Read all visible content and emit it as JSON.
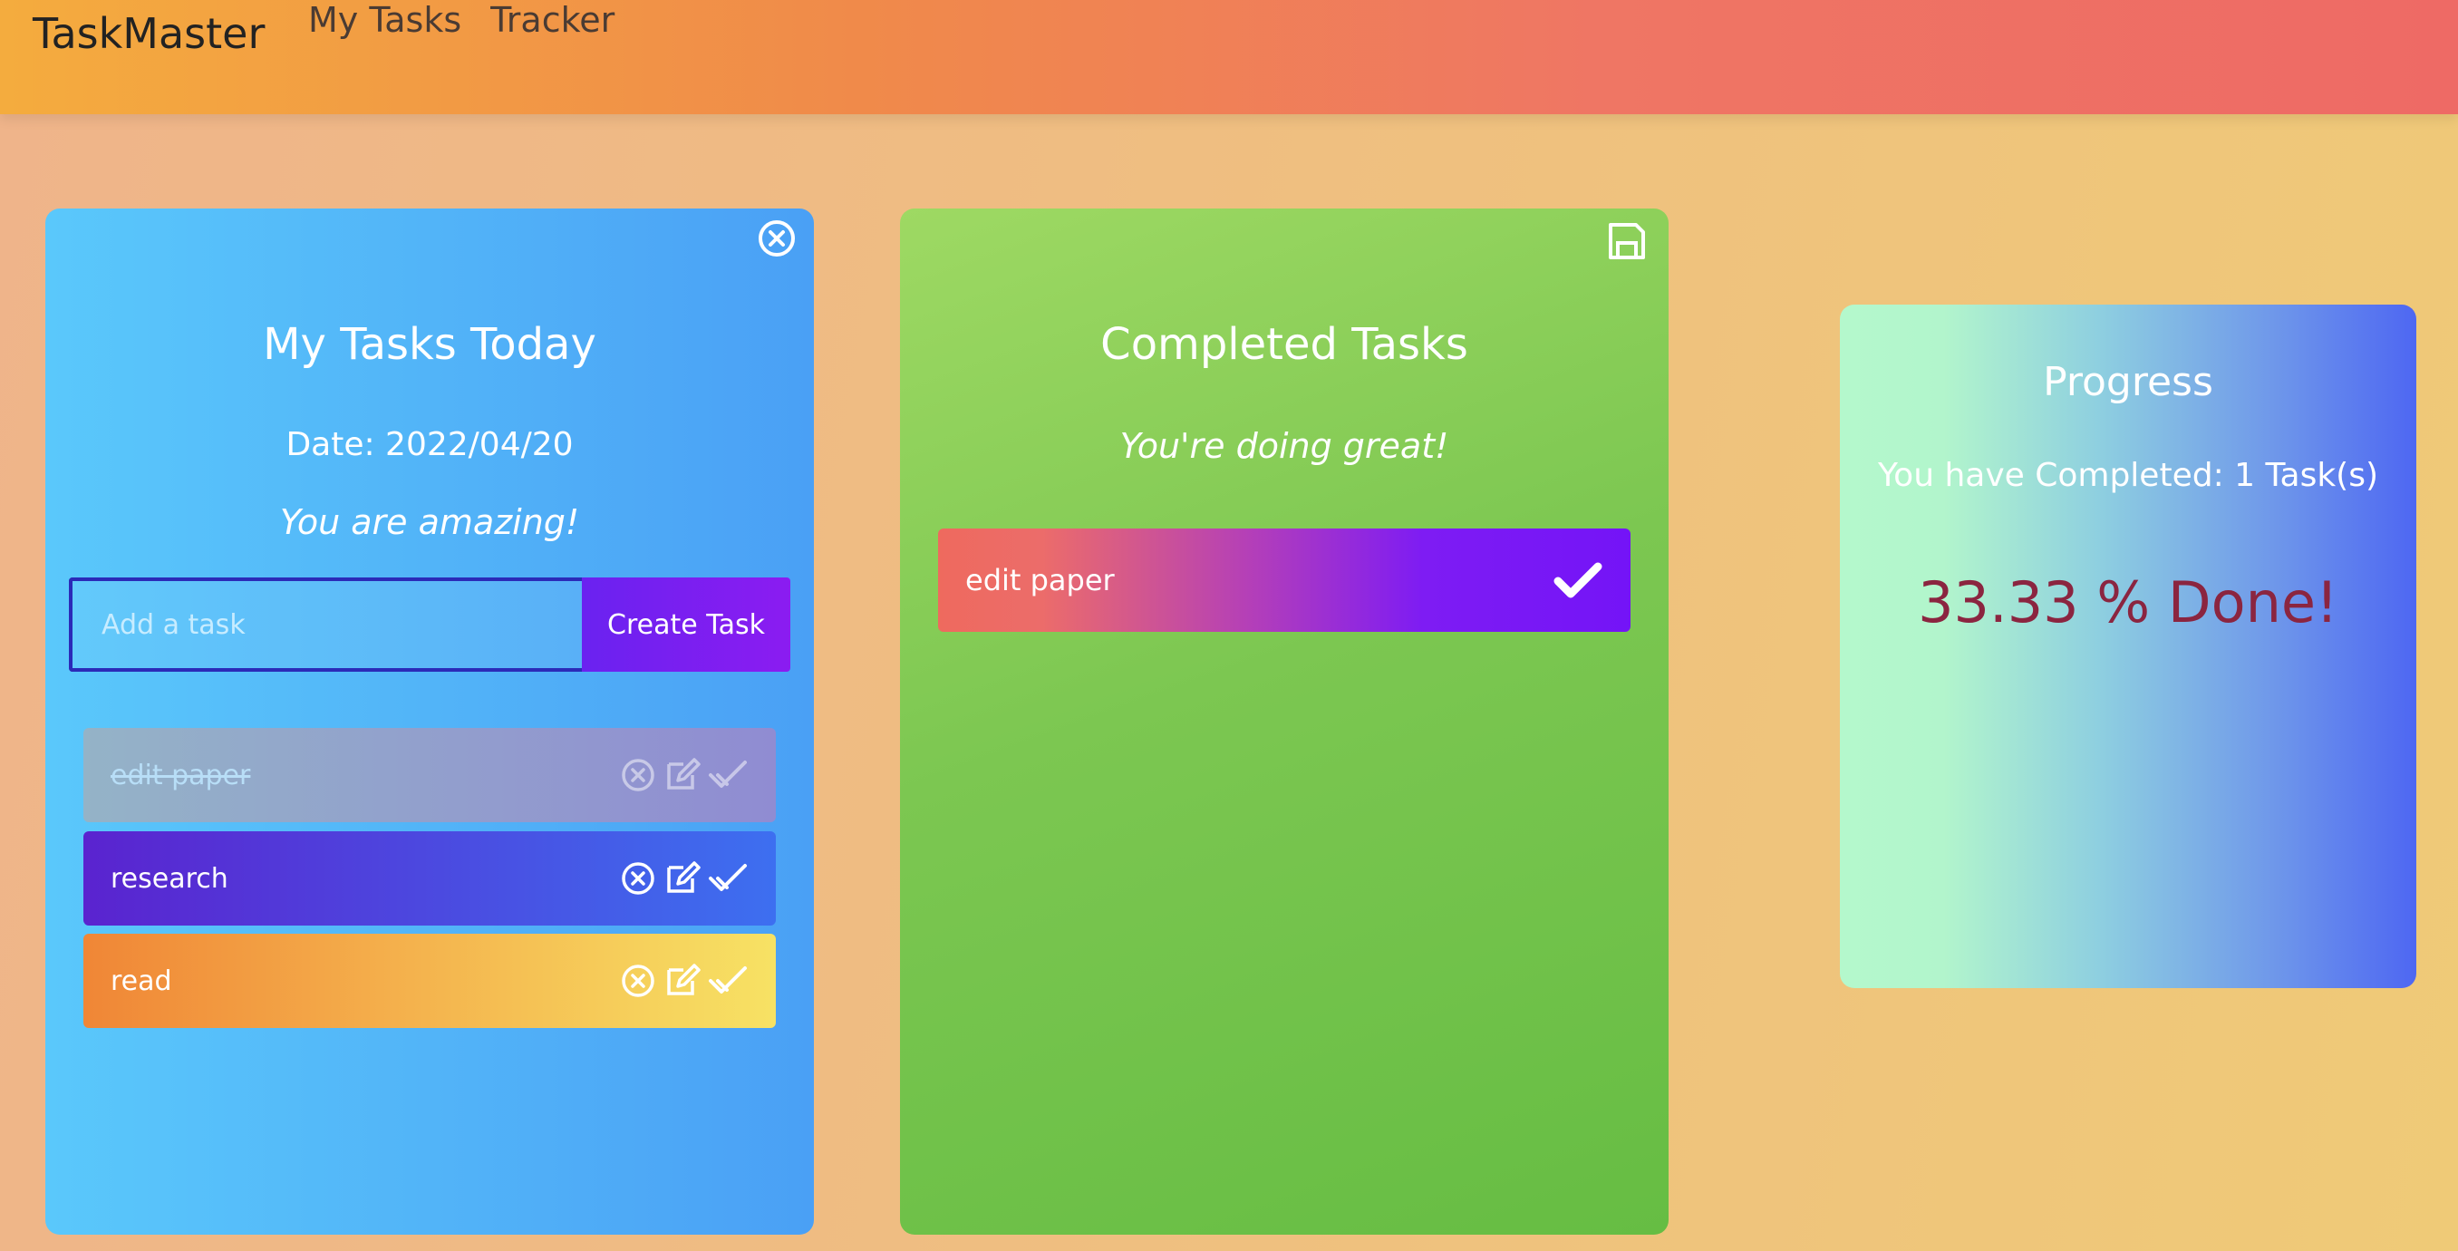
{
  "header": {
    "brand": "TaskMaster",
    "nav": [
      "My Tasks",
      "Tracker"
    ]
  },
  "tasks_card": {
    "title": "My Tasks Today",
    "date": "Date: 2022/04/20",
    "motto": "You are amazing!",
    "input_placeholder": "Add a task",
    "input_value": "",
    "create_label": "Create Task",
    "items": [
      {
        "label": "edit paper",
        "completed": true
      },
      {
        "label": "research",
        "completed": false
      },
      {
        "label": "read",
        "completed": false
      }
    ]
  },
  "completed_card": {
    "title": "Completed Tasks",
    "motto": "You're doing great!",
    "items": [
      {
        "label": "edit paper"
      }
    ]
  },
  "progress_card": {
    "title": "Progress",
    "summary": "You have Completed: 1 Task(s)",
    "percent_text": "33.33 % Done!",
    "percent_value": 33.33
  },
  "colors": {
    "percent_text": "#8b2540",
    "brand_text": "#222222",
    "nav_text": "#4a3b33",
    "input_border": "#2b2ab8",
    "create_button": "#7a1ff2"
  },
  "icons": {
    "close": "close-circle-icon",
    "save": "floppy-disk-icon",
    "edit": "edit-icon",
    "check": "double-check-icon",
    "completed_check": "check-icon"
  }
}
